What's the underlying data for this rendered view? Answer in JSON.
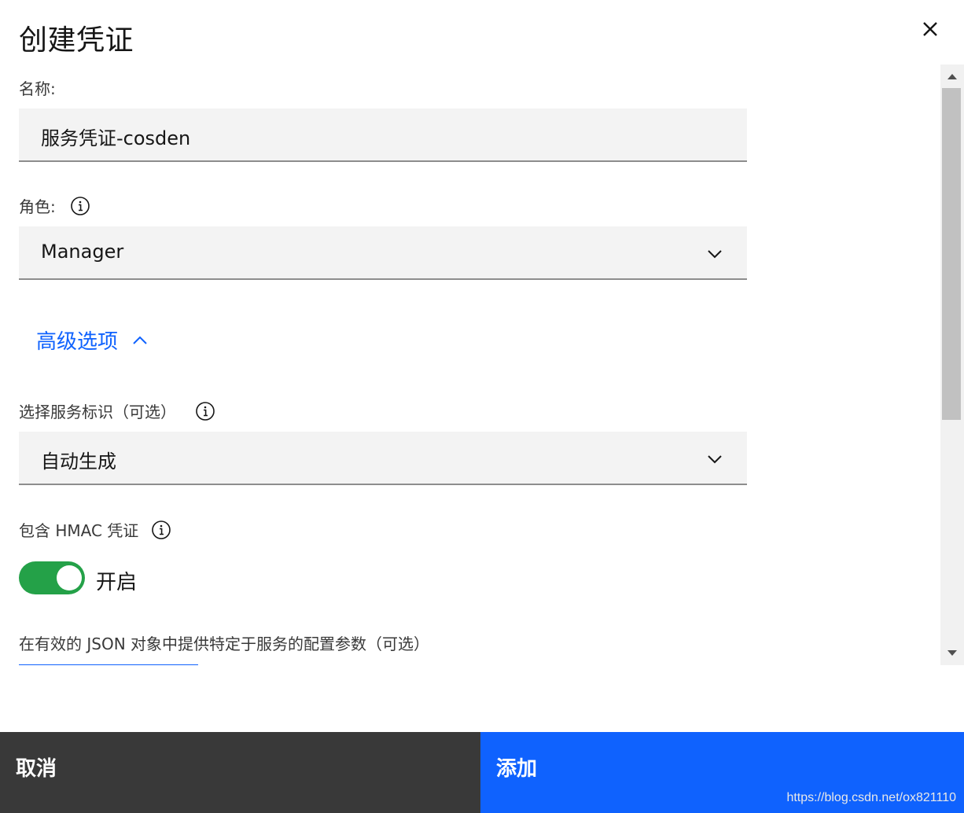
{
  "dialog": {
    "title": "创建凭证",
    "name_label": "名称:",
    "name_value": "服务凭证-cosden",
    "role_label": "角色:",
    "role_value": "Manager",
    "advanced_label": "高级选项",
    "service_id_label": "选择服务标识（可选）",
    "service_id_value": "自动生成",
    "hmac_label": "包含 HMAC 凭证",
    "hmac_state_text": "开启",
    "hmac_enabled": true,
    "json_label": "在有效的 JSON 对象中提供特定于服务的配置参数（可选）"
  },
  "footer": {
    "cancel_label": "取消",
    "add_label": "添加"
  },
  "watermark": "https://blog.csdn.net/ox821110",
  "colors": {
    "primary": "#0f62fe",
    "toggle_on": "#24a148",
    "cancel_bg": "#393939",
    "field_bg": "#f3f3f3"
  },
  "icons": [
    "close-icon",
    "info-icon",
    "chevron-down-icon",
    "chevron-up-icon"
  ]
}
